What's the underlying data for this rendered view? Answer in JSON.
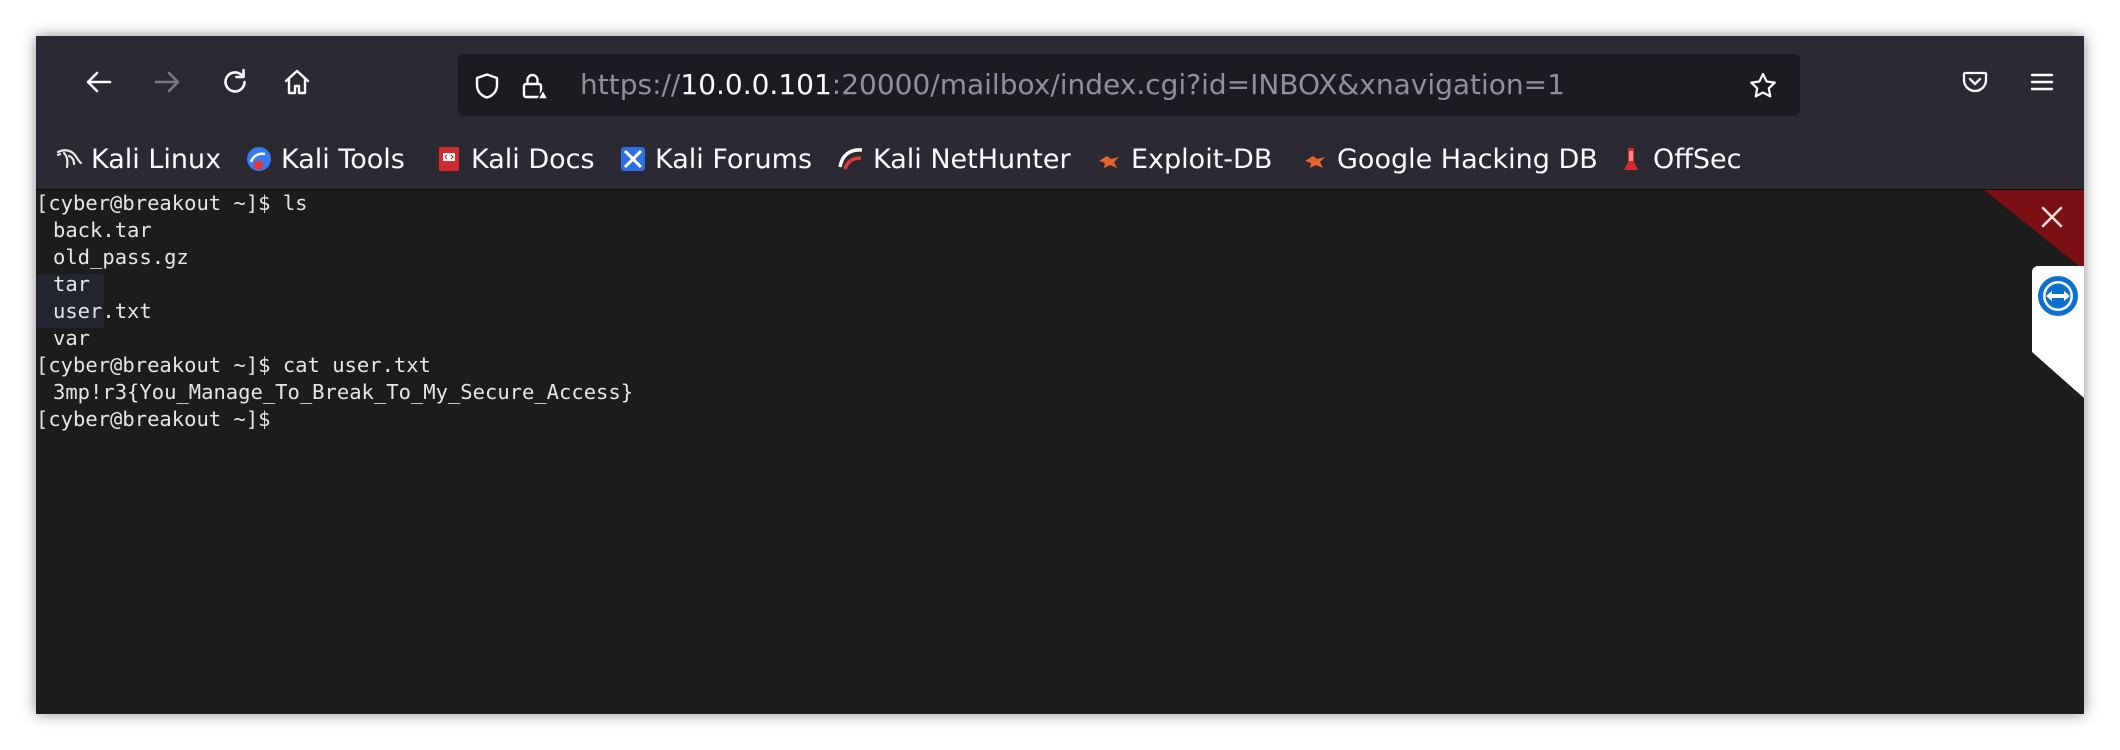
{
  "browser": {
    "url": {
      "scheme": "https://",
      "host": "10.0.0.101",
      "rest": ":20000/mailbox/index.cgi?id=INBOX&xnavigation=1"
    },
    "icons": {
      "back": "back-arrow-icon",
      "forward": "forward-arrow-icon",
      "reload": "reload-icon",
      "home": "home-icon",
      "shield": "tracking-protection-shield-icon",
      "lock": "insecure-lock-icon",
      "star": "bookmark-star-icon",
      "pocket": "pocket-icon",
      "menu": "hamburger-menu-icon"
    },
    "bookmarks": [
      {
        "label": "Kali Linux",
        "icon": "kali-dragon-icon"
      },
      {
        "label": "Kali Tools",
        "icon": "kali-tools-icon"
      },
      {
        "label": "Kali Docs",
        "icon": "kali-docs-icon"
      },
      {
        "label": "Kali Forums",
        "icon": "kali-forums-icon"
      },
      {
        "label": "Kali NetHunter",
        "icon": "kali-nethunter-icon"
      },
      {
        "label": "Exploit-DB",
        "icon": "exploit-db-icon"
      },
      {
        "label": "Google Hacking DB",
        "icon": "ghdb-icon"
      },
      {
        "label": "OffSec",
        "icon": "offsec-icon"
      }
    ]
  },
  "terminal": {
    "lines": [
      "[cyber@breakout ~]$ ls",
      "back.tar",
      "old_pass.gz",
      "tar",
      "user.txt",
      "var",
      "[cyber@breakout ~]$ cat user.txt",
      "3mp!r3{You_Manage_To_Break_To_My_Secure_Access}",
      "[cyber@breakout ~]$"
    ]
  },
  "overlay": {
    "close_icon": "close-x-icon",
    "teamviewer_icon": "teamviewer-icon",
    "colors": {
      "corner": "#7a0f14",
      "teamviewer": "#0e6fd3"
    }
  },
  "colors": {
    "toolbar": "#2b2a33",
    "urlbar": "#1c1b22",
    "terminal_bg": "#1c1c1c",
    "terminal_fg": "#e6e6e6"
  }
}
